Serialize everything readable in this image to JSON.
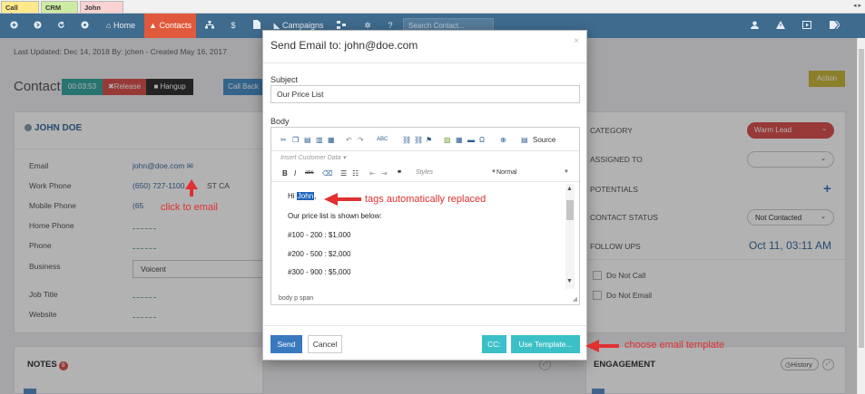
{
  "colors": {
    "nav_bg": "#3f6b8e",
    "accent_red": "#e0593c",
    "send_blue": "#3a79bd",
    "teal": "#3cc0c8",
    "annotation_red": "#e03030"
  },
  "tabs": [
    {
      "label": "Call History"
    },
    {
      "label": "CRM Home"
    },
    {
      "label": "John Doe",
      "close": "×"
    }
  ],
  "scroll_arrows": "◂ ▸",
  "nav": {
    "home": "Home",
    "contacts": "Contacts",
    "dollar": "$",
    "campaigns": "Campaigns",
    "question": "?",
    "search_placeholder": "Search Contact..."
  },
  "page": {
    "updated": "Last Updated: Dec 14, 2018 By: jchen - Created May 16, 2017",
    "title": "Contact",
    "timer": "00:03:53",
    "release": "Release",
    "hangup": "Hangup",
    "callback": "Call Back",
    "action": "Action"
  },
  "contact": {
    "name": "JOHN DOE",
    "fields": [
      {
        "label": "Email",
        "value": "john@doe.com"
      },
      {
        "label": "Work Phone",
        "value": "(650) 727-1100"
      },
      {
        "label": "Mobile Phone",
        "value": "(65"
      },
      {
        "label": "Home Phone",
        "value": ""
      },
      {
        "label": "Phone",
        "value": ""
      },
      {
        "label": "Business",
        "value": "Voicent"
      },
      {
        "label": "Job Title",
        "value": ""
      },
      {
        "label": "Website",
        "value": ""
      }
    ],
    "tz_fragment": "ST CA"
  },
  "details": {
    "category_label": "CATEGORY",
    "category_value": "Warm Lead",
    "assigned_label": "ASSIGNED TO",
    "potentials_label": "POTENTIALS",
    "plus": "+",
    "status_label": "CONTACT STATUS",
    "status_value": "Not Contacted",
    "followups_label": "FOLLOW UPS",
    "followups_date": "Oct 11, 03:11 AM",
    "do_not_call": "Do Not Call",
    "do_not_email": "Do Not Email"
  },
  "notes": {
    "title": "NOTES",
    "count": "0"
  },
  "engagement": {
    "title": "ENGAGEMENT",
    "history": "History"
  },
  "modal": {
    "title": "Send Email to: john@doe.com",
    "close": "×",
    "subject_label": "Subject",
    "subject_value": "Our Price List",
    "body_label": "Body",
    "source": "Source",
    "insert_customer_data": "Insert Customer Data",
    "styles": "Styles",
    "format": "Normal",
    "body_lines": {
      "greeting": "Hi",
      "name_tag": "John",
      "greeting_end": ",",
      "line2": "Our price list is shown below:",
      "line3": "#100 - 200 : $1,000",
      "line4": "#200 - 500 : $2,000",
      "line5": "#300 - 900 : $5,000"
    },
    "path": "body  p  span",
    "send": "Send",
    "cancel": "Cancel",
    "cc": "CC:",
    "use_template": "Use Template..."
  },
  "annotations": {
    "click_to_email": "click to email",
    "tags_replaced": "tags automatically replaced",
    "choose_template": "choose email template"
  }
}
